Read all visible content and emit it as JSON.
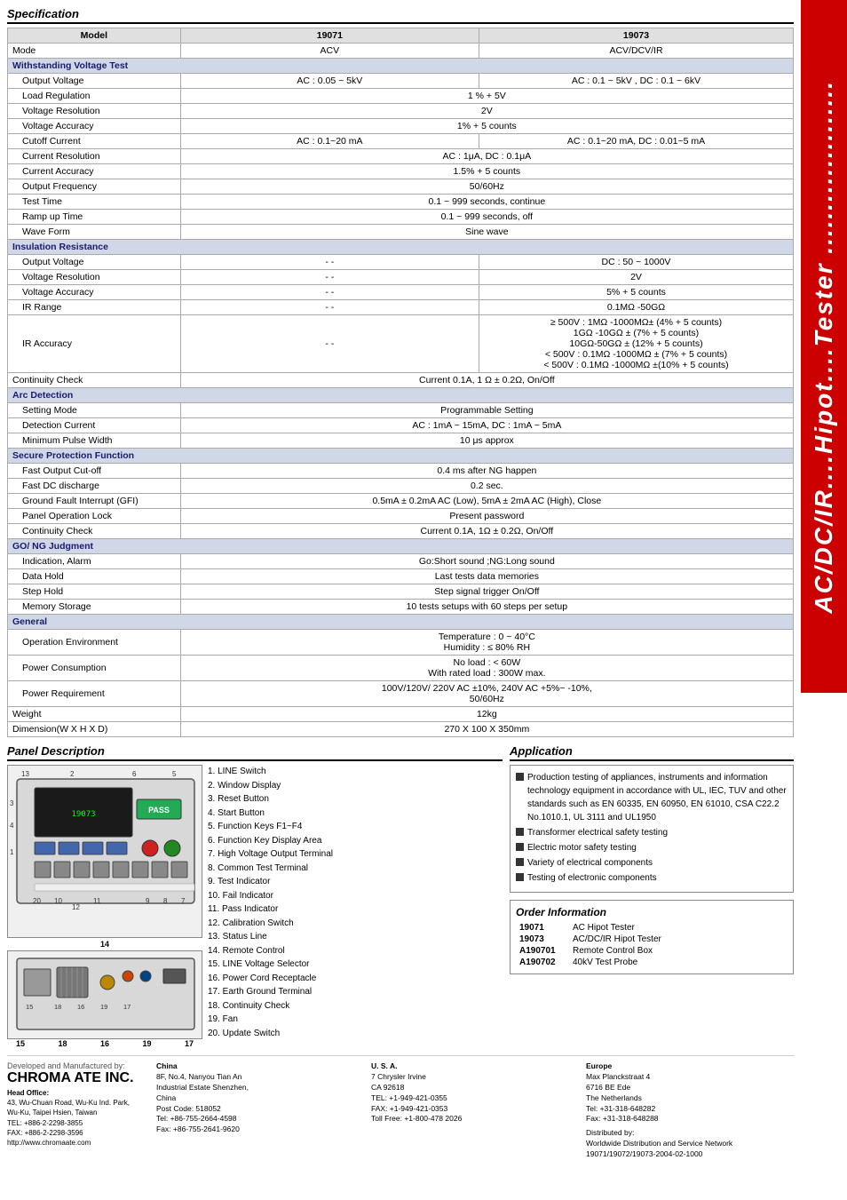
{
  "side_banner": {
    "line1": "AC/DC/IR",
    "line2": "Hipot",
    "line3": "Tester"
  },
  "spec_section_title": "Specification",
  "spec_table": {
    "headers": [
      "Model",
      "19071",
      "19073"
    ],
    "rows": [
      {
        "label": "Mode",
        "col1": "ACV",
        "col2": "ACV/DCV/IR",
        "type": "normal"
      },
      {
        "label": "Withstanding Voltage Test",
        "col1": null,
        "col2": null,
        "type": "category"
      },
      {
        "label": "Output Voltage",
        "col1": "AC : 0.05 ~ 5kV",
        "col2": "AC : 0.1 ~ 5kV , DC : 0.1 ~ 6kV",
        "type": "sub"
      },
      {
        "label": "Load Regulation",
        "col1": "1 % + 5V",
        "col2": "",
        "type": "sub",
        "span": true
      },
      {
        "label": "Voltage Resolution",
        "col1": "2V",
        "col2": "",
        "type": "sub",
        "span": true
      },
      {
        "label": "Voltage Accuracy",
        "col1": "1% + 5 counts",
        "col2": "",
        "type": "sub",
        "span": true
      },
      {
        "label": "Cutoff Current",
        "col1": "AC : 0.1~20 mA",
        "col2": "AC : 0.1~20 mA, DC : 0.01~5 mA",
        "type": "sub"
      },
      {
        "label": "Current Resolution",
        "col1": "AC : 1μA, DC : 0.1μA",
        "col2": "",
        "type": "sub",
        "span": true
      },
      {
        "label": "Current Accuracy",
        "col1": "1.5% + 5 counts",
        "col2": "",
        "type": "sub",
        "span": true
      },
      {
        "label": "Output Frequency",
        "col1": "50/60Hz",
        "col2": "",
        "type": "sub",
        "span": true
      },
      {
        "label": "Test Time",
        "col1": "0.1 ~ 999 seconds, continue",
        "col2": "",
        "type": "sub",
        "span": true
      },
      {
        "label": "Ramp up Time",
        "col1": "0.1 ~ 999 seconds, off",
        "col2": "",
        "type": "sub",
        "span": true
      },
      {
        "label": "Wave Form",
        "col1": "Sine wave",
        "col2": "",
        "type": "sub",
        "span": true
      },
      {
        "label": "Insulation Resistance",
        "col1": null,
        "col2": null,
        "type": "category"
      },
      {
        "label": "Output Voltage",
        "col1": "- -",
        "col2": "DC : 50 ~ 1000V",
        "type": "sub"
      },
      {
        "label": "Voltage Resolution",
        "col1": "- -",
        "col2": "2V",
        "type": "sub"
      },
      {
        "label": "Voltage Accuracy",
        "col1": "- -",
        "col2": "5% + 5 counts",
        "type": "sub"
      },
      {
        "label": "IR Range",
        "col1": "- -",
        "col2": "0.1MΩ -50GΩ",
        "type": "sub"
      },
      {
        "label": "IR Accuracy",
        "col1": "- -",
        "col2": "≥ 500V : 1MΩ -1000MΩ± (4% + 5 counts)\n1GΩ -10GΩ ± (7% + 5 counts)\n10GΩ-50GΩ ± (12% + 5 counts)\n< 500V : 0.1MΩ -1000MΩ ± (7% + 5 counts)\n< 500V : 0.1MΩ -1000MΩ ±(10% + 5 counts)",
        "type": "sub"
      },
      {
        "label": "Continuity Check",
        "col1": "Current 0.1A, 1 Ω ± 0.2Ω, On/Off",
        "col2": "",
        "type": "normal",
        "span": true
      },
      {
        "label": "Arc Detection",
        "col1": null,
        "col2": null,
        "type": "category"
      },
      {
        "label": "Setting Mode",
        "col1": "Programmable Setting",
        "col2": "",
        "type": "sub",
        "span": true
      },
      {
        "label": "Detection Current",
        "col1": "AC : 1mA ~ 15mA, DC : 1mA ~ 5mA",
        "col2": "",
        "type": "sub",
        "span": true
      },
      {
        "label": "Minimum Pulse Width",
        "col1": "10 μs approx",
        "col2": "",
        "type": "sub",
        "span": true
      },
      {
        "label": "Secure Protection Function",
        "col1": null,
        "col2": null,
        "type": "category"
      },
      {
        "label": "Fast Output Cut-off",
        "col1": "0.4 ms after NG happen",
        "col2": "",
        "type": "sub",
        "span": true
      },
      {
        "label": "Fast DC discharge",
        "col1": "0.2 sec.",
        "col2": "",
        "type": "sub",
        "span": true
      },
      {
        "label": "Ground Fault Interrupt (GFI)",
        "col1": "0.5mA ± 0.2mA AC (Low), 5mA ± 2mA AC (High), Close",
        "col2": "",
        "type": "sub",
        "span": true
      },
      {
        "label": "Panel Operation Lock",
        "col1": "Present password",
        "col2": "",
        "type": "sub",
        "span": true
      },
      {
        "label": "Continuity Check",
        "col1": "Current 0.1A, 1Ω ± 0.2Ω, On/Off",
        "col2": "",
        "type": "sub",
        "span": true
      },
      {
        "label": "GO/ NG Judgment",
        "col1": null,
        "col2": null,
        "type": "category"
      },
      {
        "label": "Indication, Alarm",
        "col1": "Go:Short sound ;NG:Long sound",
        "col2": "",
        "type": "sub",
        "span": true
      },
      {
        "label": "Data Hold",
        "col1": "Last tests data memories",
        "col2": "",
        "type": "sub",
        "span": true
      },
      {
        "label": "Step Hold",
        "col1": "Step signal trigger On/Off",
        "col2": "",
        "type": "sub",
        "span": true
      },
      {
        "label": "Memory Storage",
        "col1": "10 tests setups with 60 steps per setup",
        "col2": "",
        "type": "sub",
        "span": true
      },
      {
        "label": "General",
        "col1": null,
        "col2": null,
        "type": "category"
      },
      {
        "label": "Operation Environment",
        "col1": "Temperature : 0 ~ 40°C\nHumidity : ≤ 80% RH",
        "col2": "",
        "type": "sub",
        "span": true
      },
      {
        "label": "Power Consumption",
        "col1": "No load : < 60W\nWith rated load : 300W max.",
        "col2": "",
        "type": "sub",
        "span": true
      },
      {
        "label": "Power Requirement",
        "col1": "100V/120V/ 220V AC ±10%, 240V AC +5%~ -10%,\n50/60Hz",
        "col2": "",
        "type": "sub",
        "span": true
      },
      {
        "label": "Weight",
        "col1": "12kg",
        "col2": "",
        "type": "normal",
        "span": true
      },
      {
        "label": "Dimension(W X H X D)",
        "col1": "270 X 100 X 350mm",
        "col2": "",
        "type": "normal",
        "span": true
      }
    ]
  },
  "panel_section_title": "Panel Description",
  "panel_items": [
    "1. LINE Switch",
    "2. Window Display",
    "3. Reset Button",
    "4. Start Button",
    "5. Function Keys F1~F4",
    "6. Function Key Display Area",
    "7. High Voltage Output Terminal",
    "8. Common Test Terminal",
    "9. Test Indicator",
    "10. Fail Indicator",
    "11. Pass Indicator",
    "12. Calibration Switch",
    "13. Status Line",
    "14. Remote Control",
    "15. LINE Voltage Selector",
    "16. Power Cord Receptacle",
    "17. Earth Ground Terminal",
    "18. Continuity Check",
    "19. Fan",
    "20. Update Switch"
  ],
  "panel_labels": {
    "top_numbers": [
      "13",
      "2",
      "6",
      "5"
    ],
    "left_numbers": [
      "3",
      "4",
      "1"
    ],
    "bottom_left": [
      "20",
      "10",
      "12",
      "11"
    ],
    "bottom_right": [
      "8",
      "7"
    ],
    "below_label": "14",
    "bottom_row": [
      "15",
      "18",
      "16",
      "19",
      "17"
    ]
  },
  "app_section_title": "Application",
  "app_bullets": [
    "Production testing of appliances, instruments and information technology equipment in accordance with UL, IEC, TUV and other standards such as EN 60335, EN 60950, EN 61010, CSA C22.2 No.1010.1, UL 3111 and UL1950",
    "Transformer electrical safety testing",
    "Electric motor safety testing",
    "Variety of electrical components",
    "Testing of electronic components"
  ],
  "order_section_title": "Order Information",
  "order_items": [
    {
      "model": "19071",
      "desc": "AC Hipot Tester"
    },
    {
      "model": "19073",
      "desc": "AC/DC/IR Hipot Tester"
    },
    {
      "model": "A190701",
      "desc": "Remote Control Box"
    },
    {
      "model": "A190702",
      "desc": "40kV Test Probe"
    }
  ],
  "footer": {
    "developed_label": "Developed and Manufactured by:",
    "distributed_label": "Distributed by:",
    "company_name": "CHROMA ATE INC.",
    "head_office_label": "Head Office:",
    "head_office": "43, Wu-Chuan Road, Wu-Ku Ind. Park,\nWu-Ku, Taipei Hsien, Taiwan\nTEL: +886-2-2298-3855\nFAX: +886-2-2298-3596\nhttp://www.chromaate.com",
    "china_label": "China",
    "china_address": "8F, No.4, Nanyou Tian An\nIndustrial Estate Shenzhen,\nChina\nPost Code: 518052\nTel: +86-755-2664-4598\nFax: +86-755-2641-9620",
    "usa_label": "U. S. A.",
    "usa_address": "7 Chrysler Irvine\nCA 92618\nTEL: +1-949-421-0355\nFAX: +1-949-421-0353\nToll Free: +1-800-478 2026",
    "europe_label": "Europe",
    "europe_address": "Max Planckstraat 4\n6716 BE Ede\nThe Netherlands\nTel: +31-318-648282\nFax: +31-318-648288",
    "worldwide": "Worldwide Distribution and Service Network",
    "doc_number": "19071/19072/19073-2004-02-1000"
  }
}
